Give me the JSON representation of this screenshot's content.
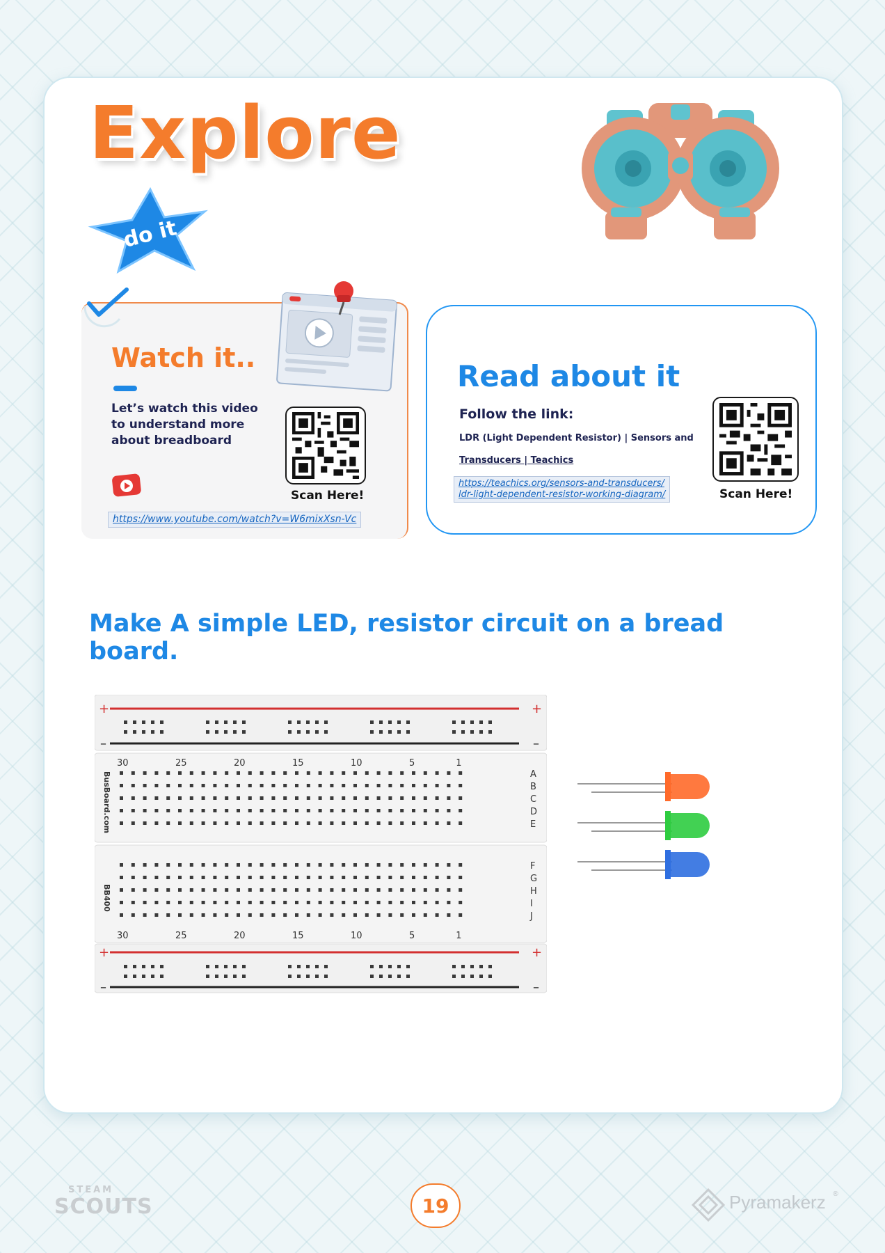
{
  "page": {
    "title": "Explore",
    "badge": "do it",
    "page_number": "19"
  },
  "watch": {
    "heading": "Watch it..",
    "text": "Let’s watch this video to understand more about breadboard",
    "scan": "Scan Here!",
    "link": "https://www.youtube.com/watch?v=W6mixXsn-Vc"
  },
  "read": {
    "heading": "Read about it",
    "follow": "Follow the link:",
    "line1": "LDR (Light Dependent Resistor) | Sensors and",
    "line2": "Transducers | Teachics",
    "link1": "https://teachics.org/sensors-and-transducers/",
    "link2": "ldr-light-dependent-resistor-working-diagram/",
    "scan": "Scan Here!"
  },
  "activity": {
    "instruction": "Make A simple LED, resistor circuit on a bread board."
  },
  "breadboard": {
    "brand": "BusBoard.com",
    "model": "BB400",
    "column_labels": [
      "30",
      "25",
      "20",
      "15",
      "10",
      "5",
      "1"
    ],
    "rows_top": [
      "A",
      "B",
      "C",
      "D",
      "E"
    ],
    "rows_bottom": [
      "F",
      "G",
      "H",
      "I",
      "J"
    ],
    "rail_plus": "+",
    "rail_minus": "–"
  },
  "leds": {
    "colors": [
      "#ff6a2a",
      "#2ecc40",
      "#2f6fe0"
    ]
  },
  "footer": {
    "steam_top": "STEAM",
    "steam_bottom": "SCOUTS",
    "brand": "Pyramakerz",
    "reg": "®"
  },
  "colors": {
    "orange": "#f47c2c",
    "blue": "#1e88e5",
    "navy": "#1e2352"
  }
}
